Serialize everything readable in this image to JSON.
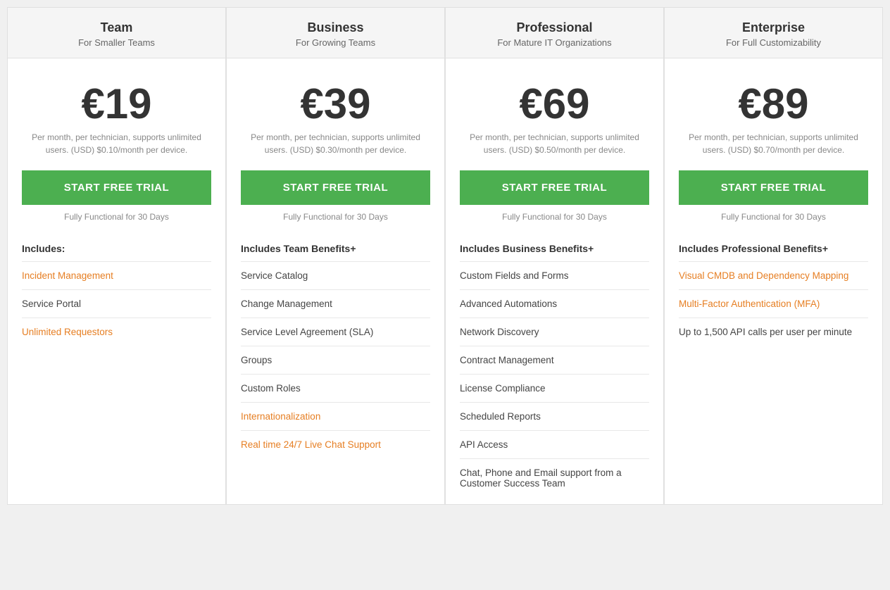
{
  "plans": [
    {
      "id": "team",
      "name": "Team",
      "subtitle": "For Smaller Teams",
      "price": "€19",
      "price_desc": "Per month, per technician, supports unlimited users. (USD) $0.10/month per device.",
      "cta": "START FREE TRIAL",
      "trial_note": "Fully Functional for 30 Days",
      "includes_label": "Includes:",
      "features": [
        {
          "text": "Incident Management",
          "highlight": true
        },
        {
          "text": "Service Portal",
          "highlight": false
        },
        {
          "text": "Unlimited Requestors",
          "highlight": true
        }
      ]
    },
    {
      "id": "business",
      "name": "Business",
      "subtitle": "For Growing Teams",
      "price": "€39",
      "price_desc": "Per month, per technician, supports unlimited users. (USD) $0.30/month per device.",
      "cta": "START FREE TRIAL",
      "trial_note": "Fully Functional for 30 Days",
      "includes_label": "Includes Team Benefits+",
      "features": [
        {
          "text": "Service Catalog",
          "highlight": false
        },
        {
          "text": "Change Management",
          "highlight": false
        },
        {
          "text": "Service Level Agreement (SLA)",
          "highlight": false
        },
        {
          "text": "Groups",
          "highlight": false
        },
        {
          "text": "Custom Roles",
          "highlight": false
        },
        {
          "text": "Internationalization",
          "highlight": true
        },
        {
          "text": "Real time 24/7 Live Chat Support",
          "highlight": true
        }
      ]
    },
    {
      "id": "professional",
      "name": "Professional",
      "subtitle": "For Mature IT Organizations",
      "price": "€69",
      "price_desc": "Per month, per technician, supports unlimited users. (USD) $0.50/month per device.",
      "cta": "START FREE TRIAL",
      "trial_note": "Fully Functional for 30 Days",
      "includes_label": "Includes Business Benefits+",
      "features": [
        {
          "text": "Custom Fields and Forms",
          "highlight": false
        },
        {
          "text": "Advanced Automations",
          "highlight": false
        },
        {
          "text": "Network Discovery",
          "highlight": false
        },
        {
          "text": "Contract Management",
          "highlight": false
        },
        {
          "text": "License Compliance",
          "highlight": false
        },
        {
          "text": "Scheduled Reports",
          "highlight": false
        },
        {
          "text": "API Access",
          "highlight": false
        },
        {
          "text": "Chat, Phone and Email support from a Customer Success Team",
          "highlight": false
        }
      ]
    },
    {
      "id": "enterprise",
      "name": "Enterprise",
      "subtitle": "For Full Customizability",
      "price": "€89",
      "price_desc": "Per month, per technician, supports unlimited users. (USD) $0.70/month per device.",
      "cta": "START FREE TRIAL",
      "trial_note": "Fully Functional for 30 Days",
      "includes_label": "Includes Professional Benefits+",
      "features": [
        {
          "text": "Visual CMDB and Dependency Mapping",
          "highlight": true
        },
        {
          "text": "Multi-Factor Authentication (MFA)",
          "highlight": true
        },
        {
          "text": "Up to 1,500 API calls per user per minute",
          "highlight": false
        }
      ]
    }
  ]
}
